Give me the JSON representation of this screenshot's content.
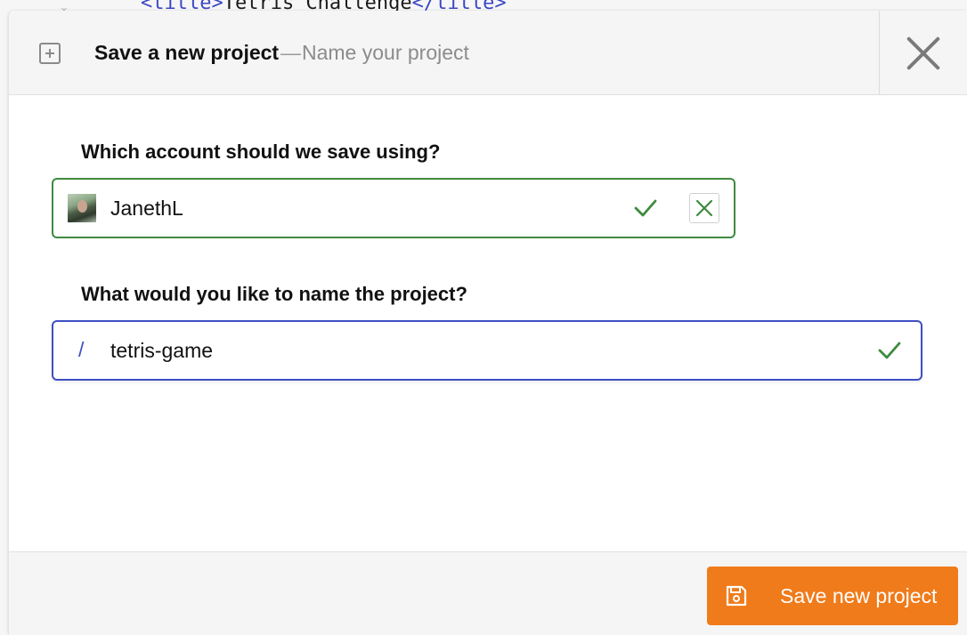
{
  "background": {
    "code_line": {
      "open_tag": "<title>",
      "text": "Tetris Challenge",
      "close_tag": "</title>"
    }
  },
  "header": {
    "title": "Save a new project",
    "separator": "—",
    "subtitle": "Name your project",
    "icons": {
      "new": "plus-box-icon",
      "close": "close-icon"
    }
  },
  "account": {
    "label": "Which account should we save using?",
    "value": "JanethL",
    "status": "valid"
  },
  "project": {
    "label": "What would you like to name the project?",
    "prefix": "/",
    "value": "tetris-game",
    "status": "valid"
  },
  "footer": {
    "save_label": "Save new project"
  },
  "colors": {
    "accent": "#f07b1a",
    "valid": "#3f8a3f",
    "focus": "#3d4fc4"
  }
}
